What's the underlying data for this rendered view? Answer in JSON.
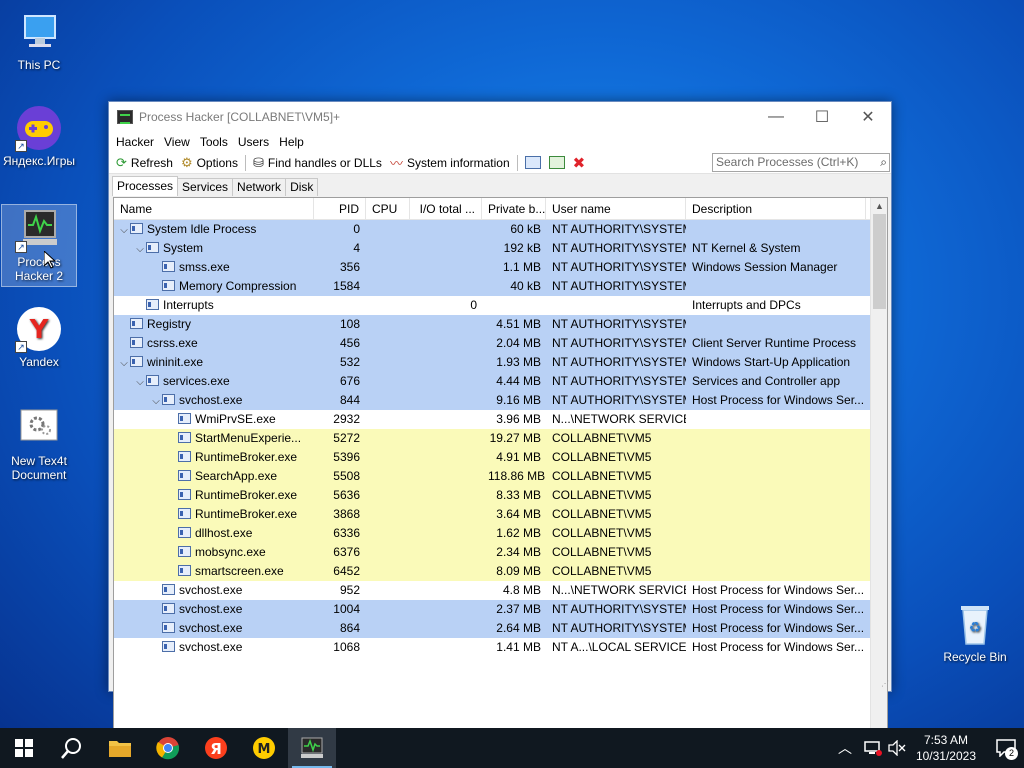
{
  "desktop": {
    "icons": [
      {
        "label": "This PC"
      },
      {
        "label": "Яндекс.Игры"
      },
      {
        "label": "Process Hacker 2"
      },
      {
        "label": "Yandex"
      },
      {
        "label": "New Tex4t Document"
      },
      {
        "label": "Recycle Bin"
      }
    ]
  },
  "window": {
    "title": "Process Hacker [COLLABNET\\VM5]+",
    "controls": {
      "minimize": "—",
      "maximize": "☐",
      "close": "✕"
    },
    "menu": [
      "Hacker",
      "View",
      "Tools",
      "Users",
      "Help"
    ],
    "toolbar": {
      "refresh": "Refresh",
      "options": "Options",
      "find_handles": "Find handles or DLLs",
      "system_info": "System information"
    },
    "search_placeholder": "Search Processes (Ctrl+K)",
    "tabs": [
      "Processes",
      "Services",
      "Network",
      "Disk"
    ],
    "columns": [
      "Name",
      "PID",
      "CPU",
      "I/O total ...",
      "Private b...",
      "User name",
      "Description"
    ],
    "rows": [
      {
        "indent": 0,
        "toggle": "v",
        "name": "System Idle Process",
        "pid": "0",
        "cpu": "",
        "io": "",
        "priv": "60 kB",
        "user": "NT AUTHORITY\\SYSTEM",
        "desc": "",
        "bg": "blue"
      },
      {
        "indent": 1,
        "toggle": "v",
        "name": "System",
        "pid": "4",
        "cpu": "",
        "io": "",
        "priv": "192 kB",
        "user": "NT AUTHORITY\\SYSTEM",
        "desc": "NT Kernel & System",
        "bg": "blue"
      },
      {
        "indent": 2,
        "toggle": "",
        "name": "smss.exe",
        "pid": "356",
        "cpu": "",
        "io": "",
        "priv": "1.1 MB",
        "user": "NT AUTHORITY\\SYSTEM",
        "desc": "Windows Session Manager",
        "bg": "blue"
      },
      {
        "indent": 2,
        "toggle": "",
        "name": "Memory Compression",
        "pid": "1584",
        "cpu": "",
        "io": "",
        "priv": "40 kB",
        "user": "NT AUTHORITY\\SYSTEM",
        "desc": "",
        "bg": "blue"
      },
      {
        "indent": 1,
        "toggle": "",
        "name": "Interrupts",
        "pid": "",
        "cpu": "",
        "io": "0",
        "priv": "",
        "user": "",
        "desc": "Interrupts and DPCs",
        "bg": "white"
      },
      {
        "indent": 0,
        "toggle": "",
        "name": "Registry",
        "pid": "108",
        "cpu": "",
        "io": "",
        "priv": "4.51 MB",
        "user": "NT AUTHORITY\\SYSTEM",
        "desc": "",
        "bg": "blue"
      },
      {
        "indent": 0,
        "toggle": "",
        "name": "csrss.exe",
        "pid": "456",
        "cpu": "",
        "io": "",
        "priv": "2.04 MB",
        "user": "NT AUTHORITY\\SYSTEM",
        "desc": "Client Server Runtime Process",
        "bg": "blue"
      },
      {
        "indent": 0,
        "toggle": "v",
        "name": "wininit.exe",
        "pid": "532",
        "cpu": "",
        "io": "",
        "priv": "1.93 MB",
        "user": "NT AUTHORITY\\SYSTEM",
        "desc": "Windows Start-Up Application",
        "bg": "blue"
      },
      {
        "indent": 1,
        "toggle": "v",
        "name": "services.exe",
        "pid": "676",
        "cpu": "",
        "io": "",
        "priv": "4.44 MB",
        "user": "NT AUTHORITY\\SYSTEM",
        "desc": "Services and Controller app",
        "bg": "blue"
      },
      {
        "indent": 2,
        "toggle": "v",
        "name": "svchost.exe",
        "pid": "844",
        "cpu": "",
        "io": "",
        "priv": "9.16 MB",
        "user": "NT AUTHORITY\\SYSTEM",
        "desc": "Host Process for Windows Ser...",
        "bg": "blue"
      },
      {
        "indent": 3,
        "toggle": "",
        "name": "WmiPrvSE.exe",
        "pid": "2932",
        "cpu": "",
        "io": "",
        "priv": "3.96 MB",
        "user": "N...\\NETWORK SERVICE",
        "desc": "",
        "bg": "white"
      },
      {
        "indent": 3,
        "toggle": "",
        "name": "StartMenuExperie...",
        "pid": "5272",
        "cpu": "",
        "io": "",
        "priv": "19.27 MB",
        "user": "COLLABNET\\VM5",
        "desc": "",
        "bg": "yellow"
      },
      {
        "indent": 3,
        "toggle": "",
        "name": "RuntimeBroker.exe",
        "pid": "5396",
        "cpu": "",
        "io": "",
        "priv": "4.91 MB",
        "user": "COLLABNET\\VM5",
        "desc": "",
        "bg": "yellow"
      },
      {
        "indent": 3,
        "toggle": "",
        "name": "SearchApp.exe",
        "pid": "5508",
        "cpu": "",
        "io": "",
        "priv": "118.86 MB",
        "user": "COLLABNET\\VM5",
        "desc": "",
        "bg": "yellow"
      },
      {
        "indent": 3,
        "toggle": "",
        "name": "RuntimeBroker.exe",
        "pid": "5636",
        "cpu": "",
        "io": "",
        "priv": "8.33 MB",
        "user": "COLLABNET\\VM5",
        "desc": "",
        "bg": "yellow"
      },
      {
        "indent": 3,
        "toggle": "",
        "name": "RuntimeBroker.exe",
        "pid": "3868",
        "cpu": "",
        "io": "",
        "priv": "3.64 MB",
        "user": "COLLABNET\\VM5",
        "desc": "",
        "bg": "yellow"
      },
      {
        "indent": 3,
        "toggle": "",
        "name": "dllhost.exe",
        "pid": "6336",
        "cpu": "",
        "io": "",
        "priv": "1.62 MB",
        "user": "COLLABNET\\VM5",
        "desc": "",
        "bg": "yellow"
      },
      {
        "indent": 3,
        "toggle": "",
        "name": "mobsync.exe",
        "pid": "6376",
        "cpu": "",
        "io": "",
        "priv": "2.34 MB",
        "user": "COLLABNET\\VM5",
        "desc": "",
        "bg": "yellow"
      },
      {
        "indent": 3,
        "toggle": "",
        "name": "smartscreen.exe",
        "pid": "6452",
        "cpu": "",
        "io": "",
        "priv": "8.09 MB",
        "user": "COLLABNET\\VM5",
        "desc": "",
        "bg": "yellow"
      },
      {
        "indent": 2,
        "toggle": "",
        "name": "svchost.exe",
        "pid": "952",
        "cpu": "",
        "io": "",
        "priv": "4.8 MB",
        "user": "N...\\NETWORK SERVICE",
        "desc": "Host Process for Windows Ser...",
        "bg": "white"
      },
      {
        "indent": 2,
        "toggle": "",
        "name": "svchost.exe",
        "pid": "1004",
        "cpu": "",
        "io": "",
        "priv": "2.37 MB",
        "user": "NT AUTHORITY\\SYSTEM",
        "desc": "Host Process for Windows Ser...",
        "bg": "blue"
      },
      {
        "indent": 2,
        "toggle": "",
        "name": "svchost.exe",
        "pid": "864",
        "cpu": "",
        "io": "",
        "priv": "2.64 MB",
        "user": "NT AUTHORITY\\SYSTEM",
        "desc": "Host Process for Windows Ser...",
        "bg": "blue"
      },
      {
        "indent": 2,
        "toggle": "",
        "name": "svchost.exe",
        "pid": "1068",
        "cpu": "",
        "io": "",
        "priv": "1.41 MB",
        "user": "NT A...\\LOCAL SERVICE",
        "desc": "Host Process for Windows Ser...",
        "bg": "white"
      }
    ]
  },
  "taskbar": {
    "apps": [
      "start-icon",
      "search-icon",
      "file-explorer-icon",
      "chrome-icon",
      "yandex-browser-icon",
      "yandex-games-icon",
      "process-hacker-icon"
    ],
    "time": "7:53 AM",
    "date": "10/31/2023",
    "notification_count": "2"
  },
  "colors": {
    "system_process": "#b9d1f5",
    "user_process": "#fafab9",
    "accent": "#0a4fba"
  }
}
